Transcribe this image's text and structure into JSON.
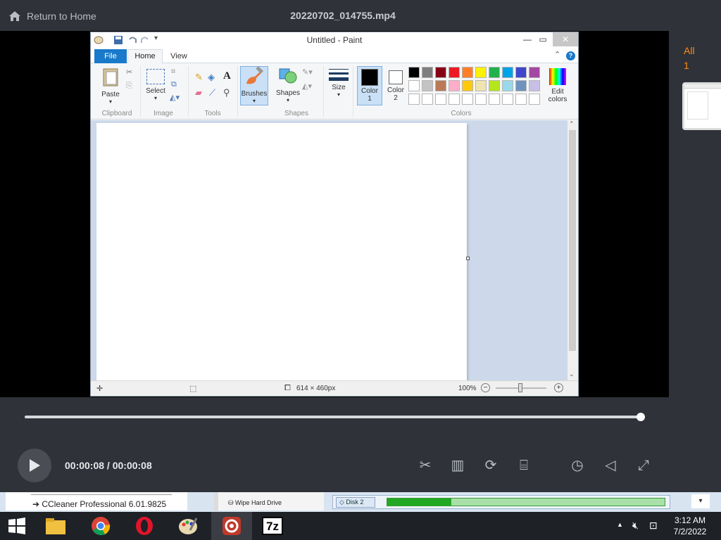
{
  "player": {
    "home_label": "Return to Home",
    "file_title": "20220702_014755.mp4",
    "panel": {
      "all_label": "All",
      "count": "1"
    },
    "time_display": "00:00:08 / 00:00:08",
    "progress_fraction": 1.0,
    "accent": "#ff8a1a"
  },
  "paint": {
    "title": "Untitled - Paint",
    "tabs": {
      "file": "File",
      "home": "Home",
      "view": "View"
    },
    "ribbon": {
      "paste": "Paste",
      "select": "Select",
      "brushes": "Brushes",
      "shapes": "Shapes",
      "size": "Size",
      "color1": "Color\n1",
      "color1_a": "Color",
      "color1_b": "1",
      "color2_a": "Color",
      "color2_b": "2",
      "edit_colors_a": "Edit",
      "edit_colors_b": "colors",
      "groups": {
        "clipboard": "Clipboard",
        "image": "Image",
        "tools": "Tools",
        "shapes": "Shapes",
        "colors": "Colors"
      },
      "palette_row1": [
        "#000000",
        "#7f7f7f",
        "#880015",
        "#ed1c24",
        "#ff7f27",
        "#fff200",
        "#22b14c",
        "#00a2e8",
        "#3f48cc",
        "#a349a4"
      ],
      "palette_row2": [
        "#ffffff",
        "#c3c3c3",
        "#b97a57",
        "#ffaec9",
        "#ffc90e",
        "#efe4b0",
        "#b5e61d",
        "#99d9ea",
        "#7092be",
        "#c8bfe7"
      ]
    },
    "status": {
      "dimensions": "614 × 460px",
      "zoom": "100%"
    }
  },
  "background": {
    "ccleaner": "CCleaner Professional 6.01.9825",
    "wipe": "Wipe Hard Drive",
    "disk": "Disk 2"
  },
  "taskbar": {
    "time": "3:12 AM",
    "date": "7/2/2022",
    "sevenzip": "7z"
  }
}
